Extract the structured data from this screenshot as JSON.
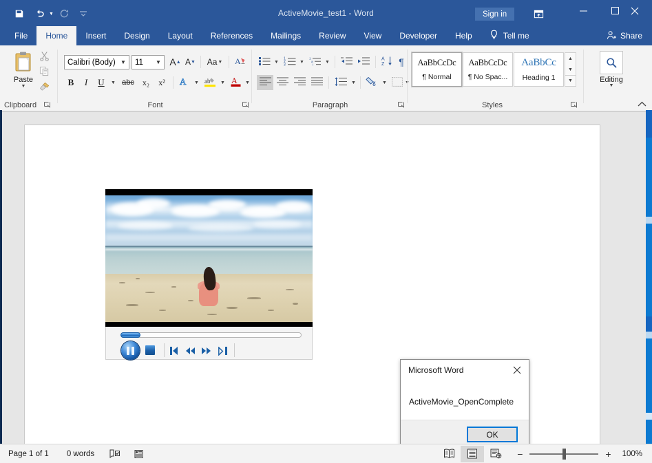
{
  "window": {
    "title": "ActiveMovie_test1  -  Word",
    "signin_label": "Sign in",
    "ribbon_display_icon": "ribbon-display-options-icon",
    "minimize_icon": "—",
    "maximize_icon": "☐",
    "close_icon": "✕"
  },
  "quick_access": {
    "save_icon": "save-icon",
    "undo_icon": "undo-icon",
    "redo_icon": "redo-icon",
    "customize_icon": "customize-quick-access-toolbar-icon"
  },
  "tabs": [
    {
      "label": "File",
      "active": false
    },
    {
      "label": "Home",
      "active": true
    },
    {
      "label": "Insert",
      "active": false
    },
    {
      "label": "Design",
      "active": false
    },
    {
      "label": "Layout",
      "active": false
    },
    {
      "label": "References",
      "active": false
    },
    {
      "label": "Mailings",
      "active": false
    },
    {
      "label": "Review",
      "active": false
    },
    {
      "label": "View",
      "active": false
    },
    {
      "label": "Developer",
      "active": false
    },
    {
      "label": "Help",
      "active": false
    }
  ],
  "tellme": {
    "label": "Tell me",
    "icon": "lightbulb-icon"
  },
  "share": {
    "label": "Share",
    "icon": "share-person-icon"
  },
  "ribbon": {
    "groups": [
      {
        "name": "Clipboard",
        "label": "Clipboard"
      },
      {
        "name": "Font",
        "label": "Font"
      },
      {
        "name": "Paragraph",
        "label": "Paragraph"
      },
      {
        "name": "Styles",
        "label": "Styles"
      }
    ],
    "clipboard": {
      "paste_label": "Paste",
      "cut_icon": "scissors-icon",
      "copy_icon": "copy-icon",
      "format_painter_icon": "format-painter-icon"
    },
    "font": {
      "font_name": "Calibri (Body)",
      "font_size": "11",
      "grow_font": "A",
      "shrink_font": "A",
      "change_case": "Aa",
      "clear_formatting_icon": "clear-formatting-icon",
      "bold": "B",
      "italic": "I",
      "underline": "U",
      "strikethrough": "abc",
      "subscript": "x₂",
      "superscript": "x²",
      "text_effects_icon": "text-effects-icon",
      "highlight_icon": "text-highlight-icon",
      "font_color_icon": "font-color-icon"
    },
    "paragraph": {
      "bullets_icon": "bullet-list-icon",
      "numbering_icon": "numbered-list-icon",
      "multilevel_icon": "multilevel-list-icon",
      "decrease_indent_icon": "decrease-indent-icon",
      "increase_indent_icon": "increase-indent-icon",
      "sort_icon": "sort-icon",
      "show_marks_icon": "paragraph-marks-icon",
      "align_left_icon": "align-left-icon",
      "align_center_icon": "align-center-icon",
      "align_right_icon": "align-right-icon",
      "justify_icon": "justify-icon",
      "line_spacing_icon": "line-spacing-icon",
      "shading_icon": "shading-icon",
      "borders_icon": "borders-icon"
    },
    "styles": {
      "items": [
        {
          "preview": "AaBbCcDc",
          "name": "¶ Normal",
          "selected": true
        },
        {
          "preview": "AaBbCcDc",
          "name": "¶ No Spac...",
          "selected": false
        },
        {
          "preview": "AaBbCc",
          "name": "Heading 1",
          "selected": false
        }
      ],
      "scroll_up_icon": "chevron-up-icon",
      "scroll_down_icon": "chevron-down-icon",
      "more_icon": "styles-more-icon"
    },
    "editing": {
      "label": "Editing",
      "icon": "search-icon"
    },
    "collapse_icon": "collapse-ribbon-icon"
  },
  "video_player": {
    "play_pause_icon": "pause-icon",
    "stop_icon": "stop-icon",
    "previous_icon": "previous-track-icon",
    "rewind_icon": "rewind-icon",
    "fast_forward_icon": "fast-forward-icon",
    "next_icon": "next-track-icon",
    "seek_position_percent": 2
  },
  "dialog": {
    "title": "Microsoft Word",
    "message": "ActiveMovie_OpenComplete",
    "ok_label": "OK",
    "close_icon": "close-icon",
    "focus_color": "#0078d7"
  },
  "status_bar": {
    "page": "Page 1 of 1",
    "words": "0 words",
    "proofing_icon": "proofing-errors-icon",
    "accessibility_icon": "accessibility-checker-icon",
    "read_mode_icon": "read-mode-icon",
    "print_layout_icon": "print-layout-icon",
    "web_layout_icon": "web-layout-icon",
    "zoom_out_icon": "−",
    "zoom_in_icon": "+",
    "zoom_level": "100%"
  },
  "theme": {
    "accent": "#2b579a",
    "tab_active_bg": "#f3f3f3",
    "ribbon_bg": "#f3f3f3",
    "canvas_bg": "#e6e6e6"
  }
}
